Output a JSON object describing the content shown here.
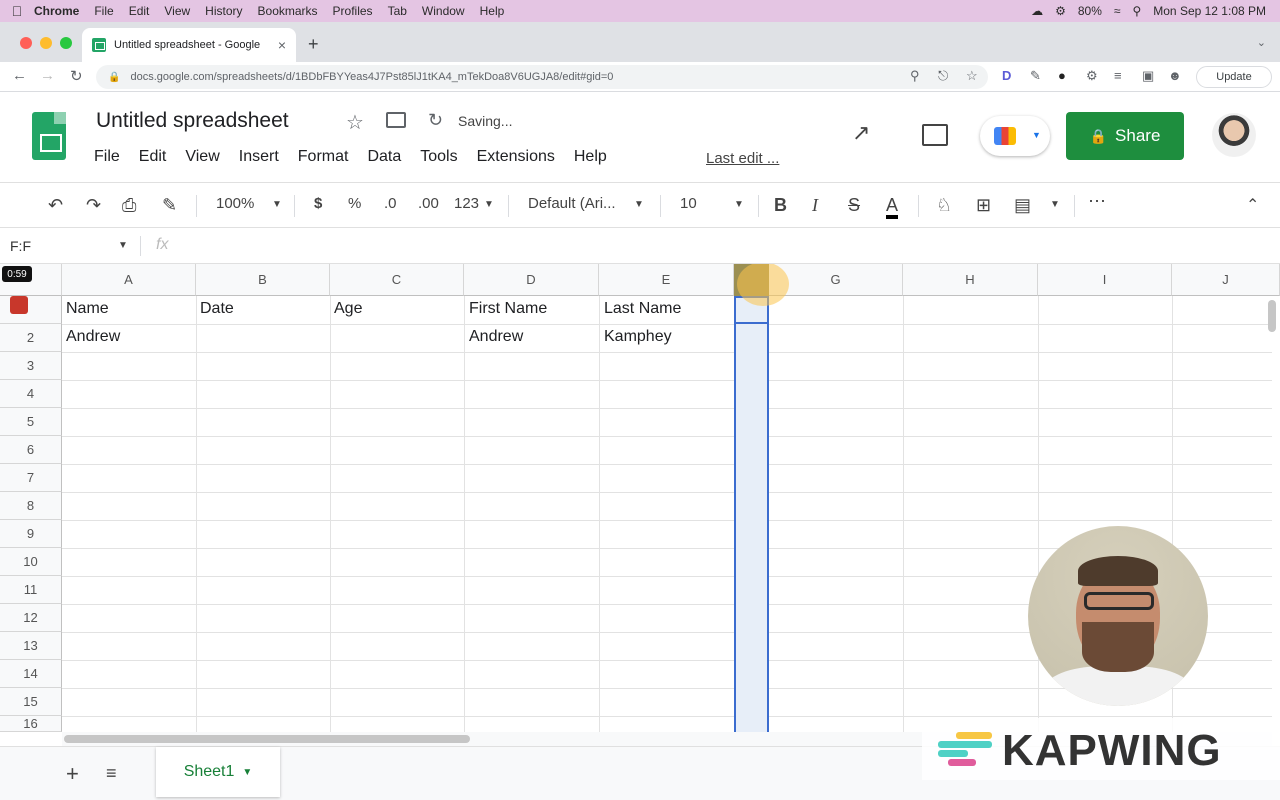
{
  "mac_menubar": {
    "items": [
      "Chrome",
      "File",
      "Edit",
      "View",
      "History",
      "Bookmarks",
      "Profiles",
      "Tab",
      "Window",
      "Help"
    ],
    "battery": "80%",
    "datetime": "Mon Sep 12  1:08 PM"
  },
  "browser": {
    "tab_title": "Untitled spreadsheet - Google",
    "url": "docs.google.com/spreadsheets/d/1BDbFBYYeas4J7Pst85lJ1tKA4_mTekDoa8V6UGJA8/edit#gid=0",
    "update_label": "Update"
  },
  "doc": {
    "title": "Untitled spreadsheet",
    "status": "Saving...",
    "menus": [
      "File",
      "Edit",
      "View",
      "Insert",
      "Format",
      "Data",
      "Tools",
      "Extensions",
      "Help"
    ],
    "last_edit": "Last edit ...",
    "share_label": "Share"
  },
  "toolbar": {
    "zoom": "100%",
    "currency": "$",
    "percent": "%",
    "decrease_decimal": ".0",
    "increase_decimal": ".00",
    "more_formats": "123",
    "font": "Default (Ari...",
    "font_size": "10",
    "bold": "B",
    "italic": "I",
    "strike": "S",
    "text_color": "A"
  },
  "formula_bar": {
    "name_box": "F:F",
    "fx": "fx"
  },
  "grid": {
    "columns": [
      "A",
      "B",
      "C",
      "D",
      "E",
      "F",
      "G",
      "H",
      "I",
      "J"
    ],
    "rows": [
      "1",
      "2",
      "3",
      "4",
      "5",
      "6",
      "7",
      "8",
      "9",
      "10",
      "11",
      "12",
      "13",
      "14",
      "15",
      "16"
    ],
    "selected_column": "F",
    "cells": {
      "A1": "Name",
      "B1": "Date",
      "C1": "Age",
      "D1": "First Name",
      "E1": "Last Name",
      "A2": "Andrew",
      "D2": "Andrew",
      "E2": "Kamphey"
    }
  },
  "recorder": {
    "timer": "0:59"
  },
  "sheet_tabs": {
    "active": "Sheet1"
  },
  "watermark": {
    "brand": "KAPWING"
  },
  "colors": {
    "menubar_bg": "#e4c5e3",
    "share_green": "#1e8e3e",
    "sheet_tab_green": "#188038",
    "selection_blue": "#3b6ccf"
  }
}
